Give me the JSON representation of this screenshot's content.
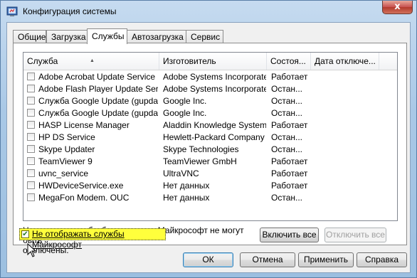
{
  "window": {
    "title": "Конфигурация системы",
    "close_glyph": "x"
  },
  "tabs": [
    {
      "label": "Общие"
    },
    {
      "label": "Загрузка"
    },
    {
      "label": "Службы"
    },
    {
      "label": "Автозагрузка"
    },
    {
      "label": "Сервис"
    }
  ],
  "services": {
    "columns": {
      "service": "Служба",
      "manufacturer": "Изготовитель",
      "status": "Состоя...",
      "date_disabled": "Дата отключе..."
    },
    "rows": [
      {
        "name": "Adobe Acrobat Update Service",
        "manufacturer": "Adobe Systems Incorporated",
        "status": "Работает",
        "checked": false
      },
      {
        "name": "Adobe Flash Player Update Service",
        "manufacturer": "Adobe Systems Incorporated",
        "status": "Остан...",
        "checked": false
      },
      {
        "name": "Служба Google Update (gupdate)",
        "manufacturer": "Google Inc.",
        "status": "Остан...",
        "checked": false
      },
      {
        "name": "Служба Google Update (gupdat...",
        "manufacturer": "Google Inc.",
        "status": "Остан...",
        "checked": false
      },
      {
        "name": "HASP License Manager",
        "manufacturer": "Aladdin Knowledge System...",
        "status": "Работает",
        "checked": false
      },
      {
        "name": "HP DS Service",
        "manufacturer": "Hewlett-Packard Company",
        "status": "Остан...",
        "checked": false
      },
      {
        "name": "Skype Updater",
        "manufacturer": "Skype Technologies",
        "status": "Остан...",
        "checked": false
      },
      {
        "name": "TeamViewer 9",
        "manufacturer": "TeamViewer GmbH",
        "status": "Работает",
        "checked": false
      },
      {
        "name": "uvnc_service",
        "manufacturer": "UltraVNC",
        "status": "Работает",
        "checked": false
      },
      {
        "name": "HWDeviceService.exe",
        "manufacturer": "Нет данных",
        "status": "Работает",
        "checked": false
      },
      {
        "name": "MegaFon Modem. OUC",
        "manufacturer": "Нет данных",
        "status": "Остан...",
        "checked": false
      }
    ]
  },
  "note_line1": "Некоторые службы безопасности Майкрософт не могут быть",
  "note_line2": "отключены.",
  "enable_all_label": "Включить все",
  "disable_all_label": "Отключить все",
  "hide_ms_label": "Не отображать службы Майкрософт",
  "hide_ms_checked": true,
  "buttons": {
    "ok": "ОК",
    "cancel": "Отмена",
    "apply": "Применить",
    "help": "Справка"
  },
  "colors": {
    "highlight": "#ffff3c",
    "title_bar": "#a9c8e6",
    "close_button": "#c75050"
  }
}
